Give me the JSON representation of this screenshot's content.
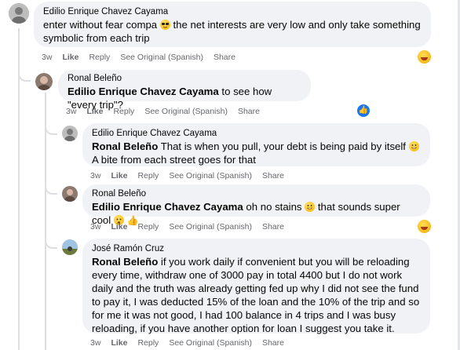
{
  "comments": [
    {
      "author": "Edilio Enrique Chavez Cayama",
      "text_before": "enter without fear compa",
      "text_after": " the net interests are very low and only take something symbolic from each trip",
      "time": "3w",
      "like": "Like",
      "reply": "Reply",
      "see_original": "See Original (Spanish)",
      "share": "Share"
    },
    {
      "author": "Ronal Beleño",
      "tag": "Edilio Enrique Chavez Cayama",
      "text": " to see how \"every trip\"?",
      "time": "3w",
      "like": "Like",
      "reply": "Reply",
      "see_original": "See Original (Spanish)",
      "share": "Share"
    },
    {
      "author": "Edilio Enrique Chavez Cayama",
      "tag": "Ronal Beleño",
      "text_before": " That is when you pull, your debt is being paid by itself ",
      "text_after": " A bite from each street goes for that",
      "time": "3w",
      "like": "Like",
      "reply": "Reply",
      "see_original": "See Original (Spanish)",
      "share": "Share"
    },
    {
      "author": "Ronal Beleño",
      "tag": "Edilio Enrique Chavez Cayama",
      "text_before": " oh no stains ",
      "text_after": " that sounds super cool ",
      "time": "3w",
      "like": "Like",
      "reply": "Reply",
      "see_original": "See Original (Spanish)",
      "share": "Share"
    },
    {
      "author": "José Ramón Cruz",
      "tag": "Ronal Beleño",
      "text": " if you work daily if convenient but you will be reloading every time, withdraw one of 3000 pay in total 4400 but I do not work daily and the truth was already getting fed up why I did not see the fund to pay it, I was deducted 15% of the loan and the 10% of the trip and so for me it was not good, I had 100 balance in 4 trips and I was busy reloading, if you have another option for loan I suggest you take it.",
      "time": "3w",
      "like": "Like",
      "reply": "Reply",
      "see_original": "See Original (Spanish)",
      "share": "Share"
    }
  ],
  "colors": {
    "bubble": "#f0f2f5",
    "meta": "#65676b",
    "like_blue": "#1877f2"
  }
}
